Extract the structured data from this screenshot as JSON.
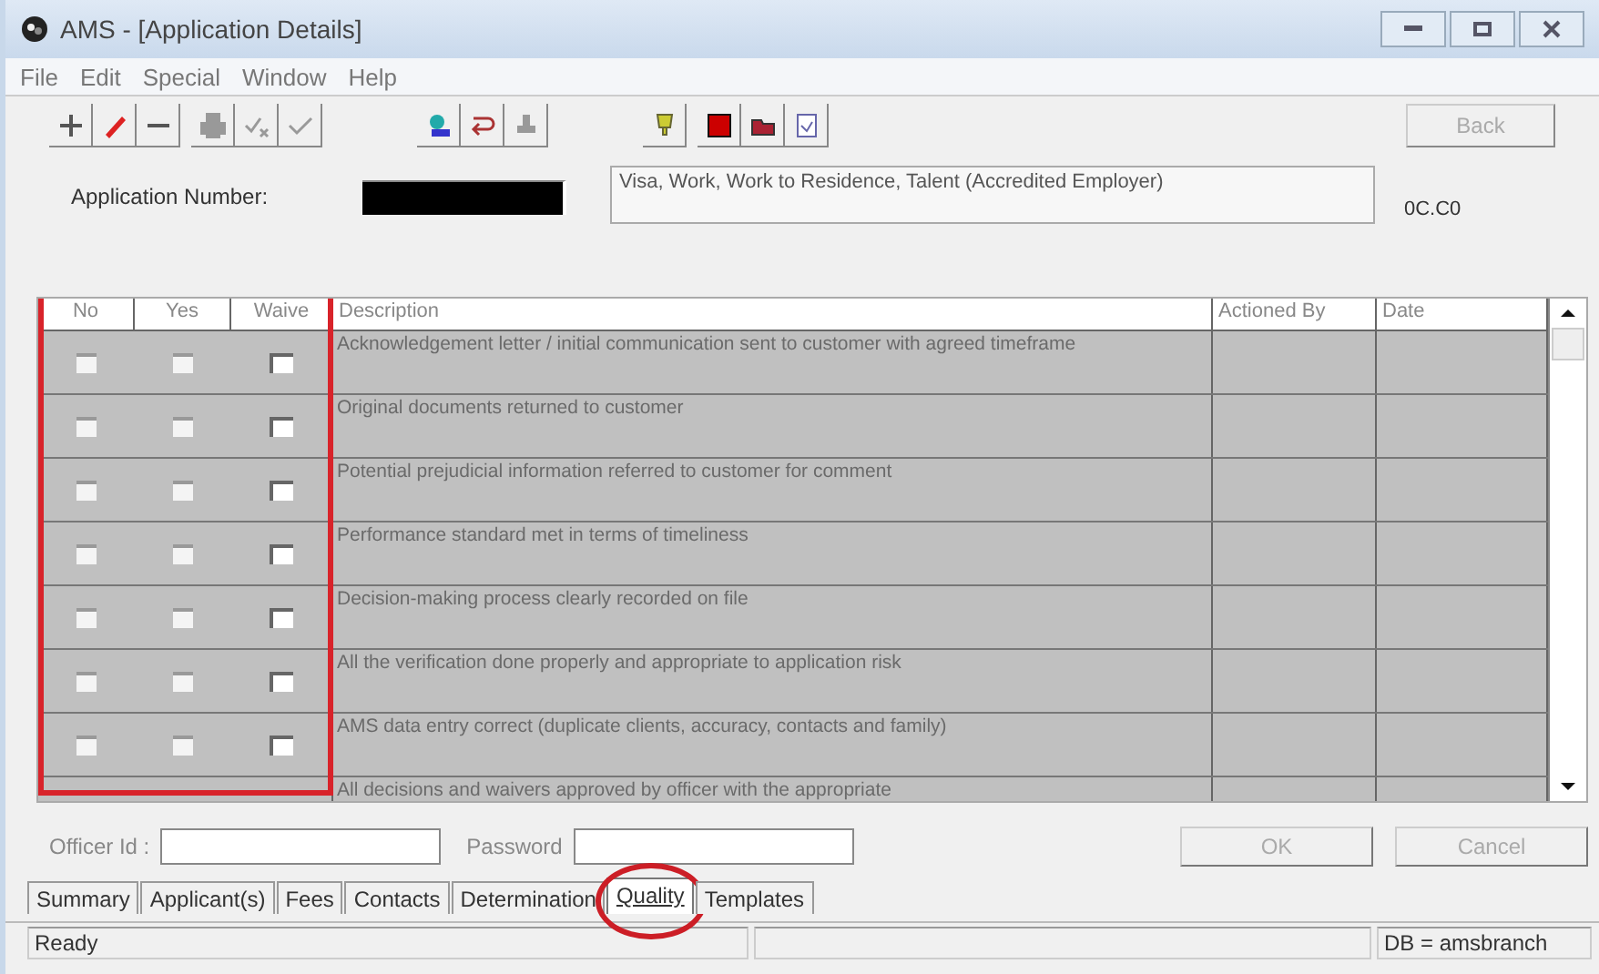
{
  "window": {
    "title": "AMS - [Application Details]"
  },
  "menu": [
    "File",
    "Edit",
    "Special",
    "Window",
    "Help"
  ],
  "toolbar": {
    "back_button": {
      "label": "Back",
      "disabled": true
    }
  },
  "application": {
    "label": "Application Number:",
    "type": "Visa, Work, Work to Residence, Talent (Accredited Employer)",
    "code": "0C.C0"
  },
  "grid": {
    "columns": [
      {
        "label": "No",
        "kind": "check",
        "disabled": true
      },
      {
        "label": "Yes",
        "kind": "check",
        "disabled": true
      },
      {
        "label": "Waive",
        "kind": "check",
        "disabled": false
      },
      {
        "label": "Description",
        "kind": "text"
      },
      {
        "label": "Actioned By",
        "kind": "text"
      },
      {
        "label": "Date",
        "kind": "text"
      }
    ],
    "rows": [
      {
        "checks": [
          false,
          false,
          false
        ],
        "description": "Acknowledgement letter / initial communication sent to customer with agreed timeframe"
      },
      {
        "checks": [
          false,
          false,
          false
        ],
        "description": "Original documents returned to customer"
      },
      {
        "checks": [
          false,
          false,
          false
        ],
        "description": "Potential prejudicial information referred to customer for comment"
      },
      {
        "checks": [
          false,
          false,
          false
        ],
        "description": "Performance standard met in terms of timeliness"
      },
      {
        "checks": [
          false,
          false,
          false
        ],
        "description": "Decision-making process clearly recorded on file"
      },
      {
        "checks": [
          false,
          false,
          false
        ],
        "description": "All the verification done properly and appropriate to application risk"
      },
      {
        "checks": [
          false,
          false,
          false
        ],
        "description": "AMS data entry correct (duplicate clients, accuracy, contacts and family)"
      },
      {
        "description": "All decisions and waivers approved by officer with the appropriate"
      }
    ]
  },
  "signoff": {
    "officer_label": "Officer Id :",
    "password_label": "Password",
    "ok": "OK",
    "cancel": "Cancel",
    "disabled": true
  },
  "tabs": [
    {
      "label": "Summary",
      "selected": false
    },
    {
      "label": "Applicant(s)",
      "selected": false
    },
    {
      "label": "Fees",
      "selected": false
    },
    {
      "label": "Contacts",
      "selected": false
    },
    {
      "label": "Determination",
      "selected": false
    },
    {
      "label": "Quality",
      "selected": true
    },
    {
      "label": "Templates",
      "selected": false
    }
  ],
  "status_bar": [
    "Ready",
    "DB = amsbranch"
  ]
}
